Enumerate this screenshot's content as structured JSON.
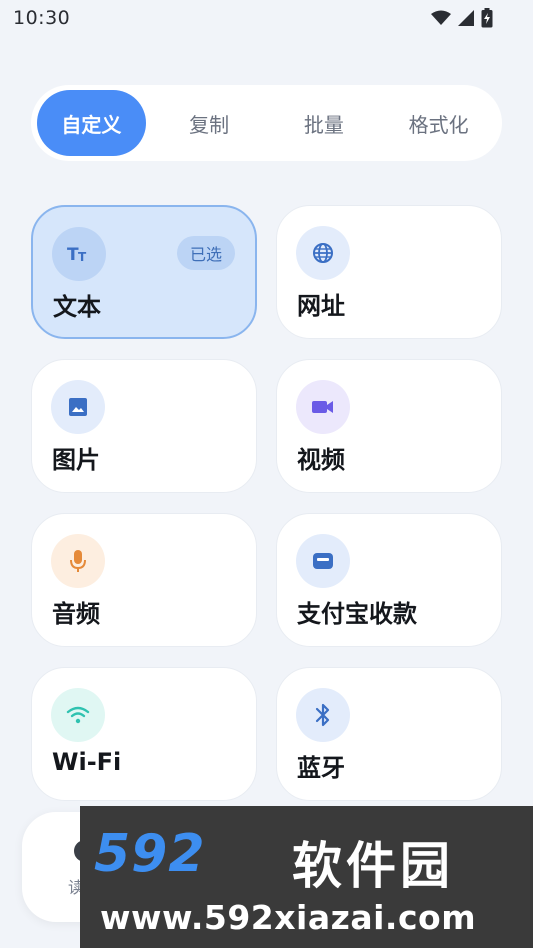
{
  "status_bar": {
    "time": "10:30",
    "icons": [
      "wifi-icon",
      "signal-icon",
      "battery-icon"
    ]
  },
  "tabs": [
    {
      "label": "自定义",
      "active": true
    },
    {
      "label": "复制",
      "active": false
    },
    {
      "label": "批量",
      "active": false
    },
    {
      "label": "格式化",
      "active": false
    }
  ],
  "cards": [
    {
      "label": "文本",
      "icon": "text-format-icon",
      "icon_color": "#3b6fc4",
      "icon_bg": "#bcd4f5",
      "badge": "已选",
      "selected": true
    },
    {
      "label": "网址",
      "icon": "globe-icon",
      "icon_color": "#3b6fc4",
      "icon_bg": "#e3ecfb",
      "selected": false
    },
    {
      "label": "图片",
      "icon": "image-icon",
      "icon_color": "#3b6fc4",
      "icon_bg": "#e3ecfb",
      "selected": false
    },
    {
      "label": "视频",
      "icon": "video-camera-icon",
      "icon_color": "#6a5be6",
      "icon_bg": "#ece8fc",
      "selected": false
    },
    {
      "label": "音频",
      "icon": "microphone-icon",
      "icon_color": "#e58a3a",
      "icon_bg": "#fdeee0",
      "selected": false
    },
    {
      "label": "支付宝收款",
      "icon": "wallet-icon",
      "icon_color": "#3b6fc4",
      "icon_bg": "#e3ecfb",
      "selected": false
    },
    {
      "label": "Wi-Fi",
      "icon": "wifi-icon",
      "icon_color": "#2fc2b0",
      "icon_bg": "#e0f7f3",
      "selected": false
    },
    {
      "label": "蓝牙",
      "icon": "bluetooth-icon",
      "icon_color": "#3b6fc4",
      "icon_bg": "#e3ecfb",
      "selected": false
    }
  ],
  "bottom_panel": {
    "partial_text": "读"
  },
  "watermark": {
    "logo": "592",
    "name": "软件园",
    "url": "www.592xiazai.com"
  }
}
